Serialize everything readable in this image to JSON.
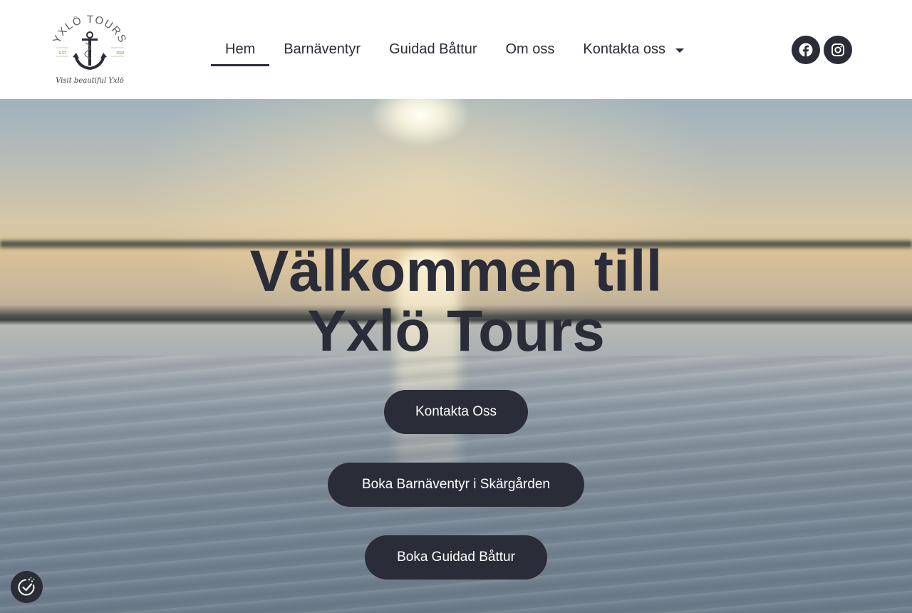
{
  "logo": {
    "top_text": "YXLÖ TOURS",
    "est": "EST.",
    "year": "2018",
    "tagline": "Visit beautiful Yxlö"
  },
  "nav": {
    "items": [
      {
        "label": "Hem",
        "active": true
      },
      {
        "label": "Barnäventyr",
        "active": false
      },
      {
        "label": "Guidad Båttur",
        "active": false
      },
      {
        "label": "Om oss",
        "active": false
      },
      {
        "label": "Kontakta oss",
        "active": false,
        "has_dropdown": true
      }
    ]
  },
  "social": {
    "facebook_icon": "facebook-icon",
    "instagram_icon": "instagram-icon"
  },
  "hero": {
    "title_line1": "Välkommen till",
    "title_line2": "Yxlö Tours",
    "buttons": [
      {
        "label": "Kontakta Oss"
      },
      {
        "label": "Boka Barnäventyr i Skärgården"
      },
      {
        "label": "Boka Guidad Båttur"
      }
    ]
  },
  "consent": {
    "icon": "cookie-consent-icon"
  },
  "colors": {
    "primary": "#2a2c38",
    "background": "#ffffff",
    "button_text": "#ffffff"
  }
}
